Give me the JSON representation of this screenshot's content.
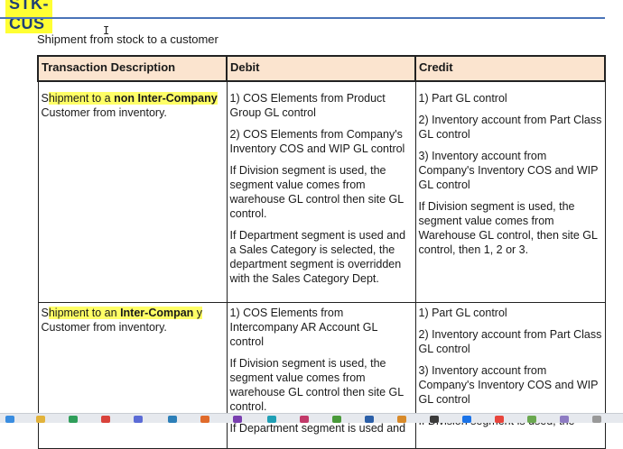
{
  "heading": "STK-CUS",
  "intro": "Shipment from stock to a customer",
  "table": {
    "headers": [
      "Transaction Description",
      "Debit",
      "Credit"
    ],
    "rows": [
      {
        "desc_pre": "S",
        "desc_hl": "hipment to a ",
        "desc_bold": "non Inter-Company",
        "desc_tail": "Customer from inventory.",
        "debit": [
          "1) COS Elements from Product Group GL control",
          "2) COS Elements from Company's Inventory COS and WIP GL control",
          "If Division segment is used, the segment value comes from warehouse GL control then site GL control.",
          "If Department segment is used and a Sales Category is selected, the department segment is overridden with the Sales Category Dept."
        ],
        "credit": [
          "1) Part GL control",
          "2) Inventory account from Part Class GL control",
          "3) Inventory account from Company's Inventory COS and WIP GL control",
          "If Division segment is used, the segment value comes from Warehouse GL control, then site GL control, then 1, 2 or 3."
        ]
      },
      {
        "desc_pre": "S",
        "desc_hl": "hipment to an ",
        "desc_bold": "Inter-Compan",
        "desc_after_bold": " y",
        "desc_tail": "Customer from inventory.",
        "debit": [
          "1) COS Elements from Intercompany AR Account GL control",
          "If Division segment is used, the segment value comes from warehouse GL control then site GL control.",
          "If Department segment is used and"
        ],
        "credit": [
          "1) Part GL control",
          "2) Inventory account from Part Class GL control",
          "3) Inventory account from Company's Inventory COS and WIP GL control",
          "If Division segment is used, the"
        ]
      }
    ]
  },
  "colors": {
    "heading_bg": "#ffff33",
    "heading_text": "#1f3f74",
    "rule": "#4a74b8",
    "header_bg": "#fbe4cf",
    "highlight": "#ffff66"
  },
  "taskbar_icons": [
    "taskbar-app-icon"
  ]
}
